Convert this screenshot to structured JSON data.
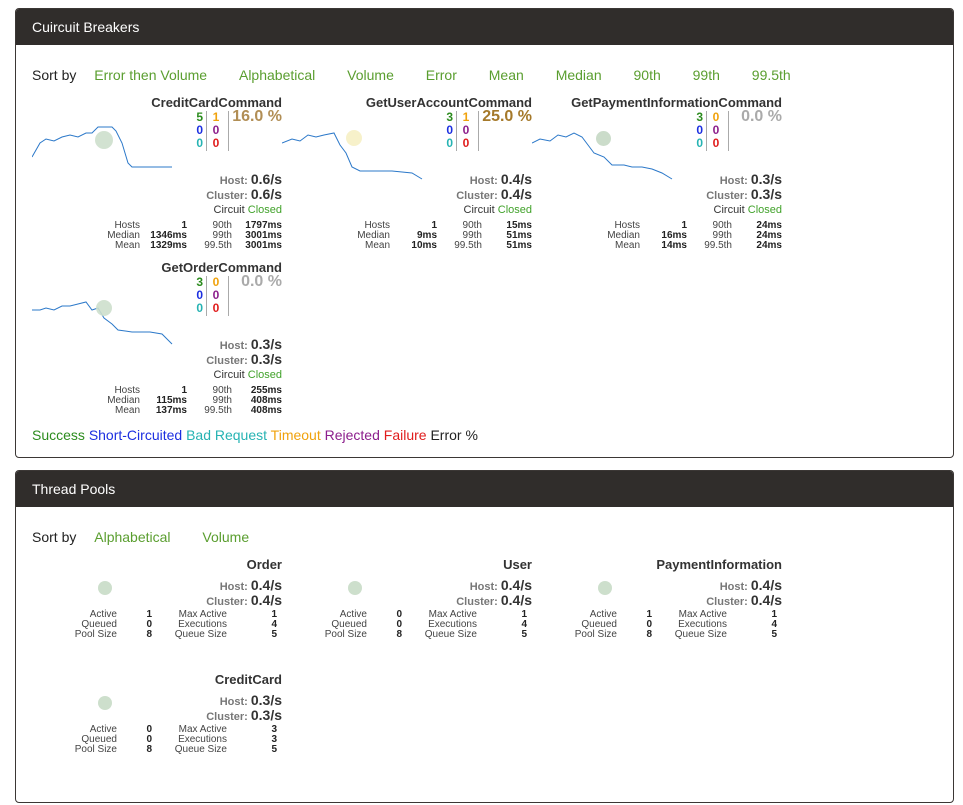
{
  "circuit_breakers": {
    "header": "Cuircuit Breakers",
    "sort_label": "Sort by",
    "sort_options": [
      "Error then Volume",
      "Alphabetical",
      "Volume",
      "Error",
      "Mean",
      "Median",
      "90th",
      "99th",
      "99.5th"
    ],
    "commands": [
      {
        "name": "CreditCardCommand",
        "success": "5",
        "short_circuited": "0",
        "bad_request": "0",
        "timeout": "1",
        "rejected": "0",
        "failure": "0",
        "error_pct": "16.0 %",
        "error_color": "#b18e55",
        "host_label": "Host:",
        "host_rate": "0.6/s",
        "cluster_label": "Cluster:",
        "cluster_rate": "0.6/s",
        "circuit_label": "Circuit",
        "circuit_state": "Closed",
        "hosts_label": "Hosts",
        "hosts": "1",
        "median_label": "Median",
        "median": "1346ms",
        "mean_label": "Mean",
        "mean": "1329ms",
        "p90_label": "90th",
        "p90": "1797ms",
        "p99_label": "99th",
        "p99": "3001ms",
        "p995_label": "99.5th",
        "p995": "3001ms",
        "bubble_color": "#cddfcc"
      },
      {
        "name": "GetUserAccountCommand",
        "success": "3",
        "short_circuited": "0",
        "bad_request": "0",
        "timeout": "1",
        "rejected": "0",
        "failure": "0",
        "error_pct": "25.0 %",
        "error_color": "#a5792a",
        "host_label": "Host:",
        "host_rate": "0.4/s",
        "cluster_label": "Cluster:",
        "cluster_rate": "0.4/s",
        "circuit_label": "Circuit",
        "circuit_state": "Closed",
        "hosts_label": "Hosts",
        "hosts": "1",
        "median_label": "Median",
        "median": "9ms",
        "mean_label": "Mean",
        "mean": "10ms",
        "p90_label": "90th",
        "p90": "15ms",
        "p99_label": "99th",
        "p99": "51ms",
        "p995_label": "99.5th",
        "p995": "51ms",
        "bubble_color": "#f6efc4"
      },
      {
        "name": "GetPaymentInformationCommand",
        "success": "3",
        "short_circuited": "0",
        "bad_request": "0",
        "timeout": "0",
        "rejected": "0",
        "failure": "0",
        "error_pct": "0.0 %",
        "error_color": "#aaaaaa",
        "host_label": "Host:",
        "host_rate": "0.3/s",
        "cluster_label": "Cluster:",
        "cluster_rate": "0.3/s",
        "circuit_label": "Circuit",
        "circuit_state": "Closed",
        "hosts_label": "Hosts",
        "hosts": "1",
        "median_label": "Median",
        "median": "16ms",
        "mean_label": "Mean",
        "mean": "14ms",
        "p90_label": "90th",
        "p90": "24ms",
        "p99_label": "99th",
        "p99": "24ms",
        "p995_label": "99.5th",
        "p995": "24ms",
        "bubble_color": "#c5d8c4"
      },
      {
        "name": "GetOrderCommand",
        "success": "3",
        "short_circuited": "0",
        "bad_request": "0",
        "timeout": "0",
        "rejected": "0",
        "failure": "0",
        "error_pct": "0.0 %",
        "error_color": "#aaaaaa",
        "host_label": "Host:",
        "host_rate": "0.3/s",
        "cluster_label": "Cluster:",
        "cluster_rate": "0.3/s",
        "circuit_label": "Circuit",
        "circuit_state": "Closed",
        "hosts_label": "Hosts",
        "hosts": "1",
        "median_label": "Median",
        "median": "115ms",
        "mean_label": "Mean",
        "mean": "137ms",
        "p90_label": "90th",
        "p90": "255ms",
        "p99_label": "99th",
        "p99": "408ms",
        "p995_label": "99.5th",
        "p995": "408ms",
        "bubble_color": "#cddfcc"
      }
    ],
    "legend": [
      {
        "label": "Success",
        "color": "#2c8c1e"
      },
      {
        "label": "Short-Circuited",
        "color": "#1c2fe0"
      },
      {
        "label": "Bad Request",
        "color": "#26b3b3"
      },
      {
        "label": "Timeout",
        "color": "#f0a20c"
      },
      {
        "label": "Rejected",
        "color": "#8c1e8c"
      },
      {
        "label": "Failure",
        "color": "#e01c1c"
      },
      {
        "label": "Error %",
        "color": "#222222"
      }
    ]
  },
  "thread_pools": {
    "header": "Thread Pools",
    "sort_label": "Sort by",
    "sort_options": [
      "Alphabetical",
      "Volume"
    ],
    "pools": [
      {
        "name": "Order",
        "host_label": "Host:",
        "host_rate": "0.4/s",
        "cluster_label": "Cluster:",
        "cluster_rate": "0.4/s",
        "active_label": "Active",
        "active": "1",
        "queued_label": "Queued",
        "queued": "0",
        "pool_size_label": "Pool Size",
        "pool_size": "8",
        "max_active_label": "Max Active",
        "max_active": "1",
        "executions_label": "Executions",
        "executions": "4",
        "queue_size_label": "Queue Size",
        "queue_size": "5"
      },
      {
        "name": "User",
        "host_label": "Host:",
        "host_rate": "0.4/s",
        "cluster_label": "Cluster:",
        "cluster_rate": "0.4/s",
        "active_label": "Active",
        "active": "0",
        "queued_label": "Queued",
        "queued": "0",
        "pool_size_label": "Pool Size",
        "pool_size": "8",
        "max_active_label": "Max Active",
        "max_active": "1",
        "executions_label": "Executions",
        "executions": "4",
        "queue_size_label": "Queue Size",
        "queue_size": "5"
      },
      {
        "name": "PaymentInformation",
        "host_label": "Host:",
        "host_rate": "0.4/s",
        "cluster_label": "Cluster:",
        "cluster_rate": "0.4/s",
        "active_label": "Active",
        "active": "1",
        "queued_label": "Queued",
        "queued": "0",
        "pool_size_label": "Pool Size",
        "pool_size": "8",
        "max_active_label": "Max Active",
        "max_active": "1",
        "executions_label": "Executions",
        "executions": "4",
        "queue_size_label": "Queue Size",
        "queue_size": "5"
      },
      {
        "name": "CreditCard",
        "host_label": "Host:",
        "host_rate": "0.3/s",
        "cluster_label": "Cluster:",
        "cluster_rate": "0.3/s",
        "active_label": "Active",
        "active": "0",
        "queued_label": "Queued",
        "queued": "0",
        "pool_size_label": "Pool Size",
        "pool_size": "8",
        "max_active_label": "Max Active",
        "max_active": "3",
        "executions_label": "Executions",
        "executions": "3",
        "queue_size_label": "Queue Size",
        "queue_size": "5"
      }
    ]
  },
  "colors": {
    "header_bg": "#302d2b",
    "sort_link": "#5a9e2f",
    "circuit_closed": "#41a22a",
    "sparkline": "#2b78c9"
  }
}
